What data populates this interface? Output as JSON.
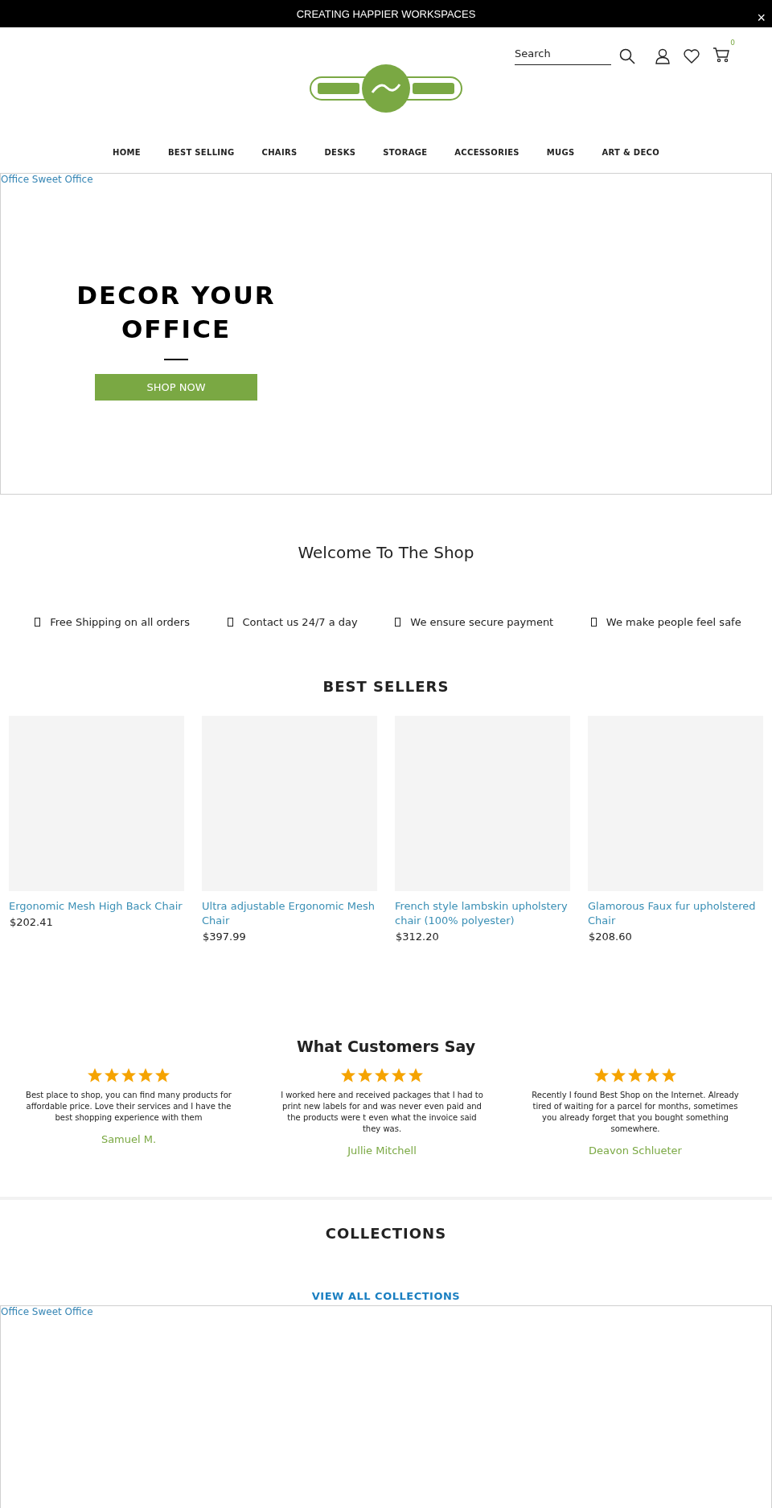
{
  "announcement": {
    "text": "CREATING HAPPIER WORKSPACES",
    "close": "×"
  },
  "header": {
    "search": {
      "placeholder": "Search"
    },
    "cart_count": "0"
  },
  "nav": [
    {
      "label": "HOME"
    },
    {
      "label": "BEST SELLING"
    },
    {
      "label": "CHAIRS"
    },
    {
      "label": "DESKS"
    },
    {
      "label": "STORAGE"
    },
    {
      "label": "ACCESSORIES"
    },
    {
      "label": "MUGS"
    },
    {
      "label": "ART & DECO"
    }
  ],
  "hero": {
    "alt_text": "Office Sweet Office",
    "title": "DECOR YOUR OFFICE",
    "button": "SHOP NOW"
  },
  "welcome": {
    "title": "Welcome To The Shop"
  },
  "features": [
    {
      "text": "Free Shipping on all orders"
    },
    {
      "text": "Contact us 24/7 a day"
    },
    {
      "text": "We ensure secure payment"
    },
    {
      "text": "We make people feel safe"
    }
  ],
  "best_sellers": {
    "title": "BEST SELLERS",
    "products": [
      {
        "name": "Ergonomic Mesh High Back Chair",
        "price": "$202.41"
      },
      {
        "name": "Ultra adjustable Ergonomic Mesh Chair",
        "price": "$397.99"
      },
      {
        "name": "French style lambskin upholstery chair (100% polyester)",
        "price": "$312.20"
      },
      {
        "name": "Glamorous Faux fur upholstered Chair",
        "price": "$208.60"
      }
    ]
  },
  "testimonials": {
    "title": "What Customers Say",
    "reviews": [
      {
        "stars": 5,
        "text": "Best place to shop, you can find many products for affordable price. Love their services and I have the best shopping experience with them",
        "author": "Samuel M."
      },
      {
        "stars": 5,
        "text": "I worked here and received packages that I had to print new labels for and was never even paid and the products were t even what the invoice said they was.",
        "author": "Jullie Mitchell"
      },
      {
        "stars": 5,
        "text": "Recently I found Best Shop on the Internet. Already tired of waiting for a parcel for months, sometimes you already forget that you bought something somewhere.",
        "author": "Deavon Schlueter"
      }
    ]
  },
  "collections": {
    "title": "COLLECTIONS",
    "link": "VIEW ALL COLLECTIONS",
    "alt_text": "Office Sweet Office"
  }
}
